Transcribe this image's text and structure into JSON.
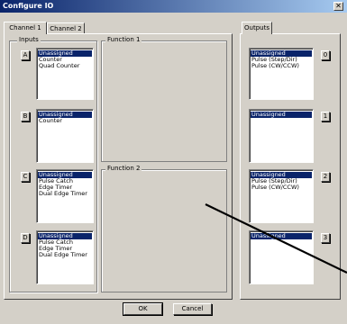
{
  "window": {
    "title": "Configure IO",
    "close_glyph": "✕"
  },
  "tabs": [
    "Channel 1",
    "Channel 2"
  ],
  "outputs_tab": "Outputs",
  "inputs_label": "Inputs",
  "function1_label": "Function 1",
  "function2_label": "Function 2",
  "inputs": [
    {
      "letter": "A",
      "items": [
        "Unassigned",
        "Counter",
        "Quad Counter"
      ],
      "selected": 0
    },
    {
      "letter": "B",
      "items": [
        "Unassigned",
        "Counter"
      ],
      "selected": 0
    },
    {
      "letter": "C",
      "items": [
        "Unassigned",
        "Pulse Catch",
        "Edge Timer",
        "Dual Edge Timer"
      ],
      "selected": 0
    },
    {
      "letter": "D",
      "items": [
        "Unassigned",
        "Pulse Catch",
        "Edge Timer",
        "Dual Edge Timer"
      ],
      "selected": 0
    }
  ],
  "outputs": [
    {
      "number": "0",
      "items": [
        "Unassigned",
        "Pulse (Step/Dir)",
        "Pulse (CW/CCW)"
      ],
      "selected": 0
    },
    {
      "number": "1",
      "items": [
        "Unassigned"
      ],
      "selected": 0
    },
    {
      "number": "2",
      "items": [
        "Unassigned",
        "Pulse (Step/Dir)",
        "Pulse (CW/CCW)"
      ],
      "selected": 0
    },
    {
      "number": "3",
      "items": [
        "Unassigned"
      ],
      "selected": 0
    }
  ],
  "buttons": {
    "ok": "OK",
    "cancel": "Cancel"
  },
  "colors": {
    "title_start": "#0a246a",
    "title_end": "#a6caf0",
    "selection": "#0a246a",
    "face": "#d4d0c8"
  }
}
